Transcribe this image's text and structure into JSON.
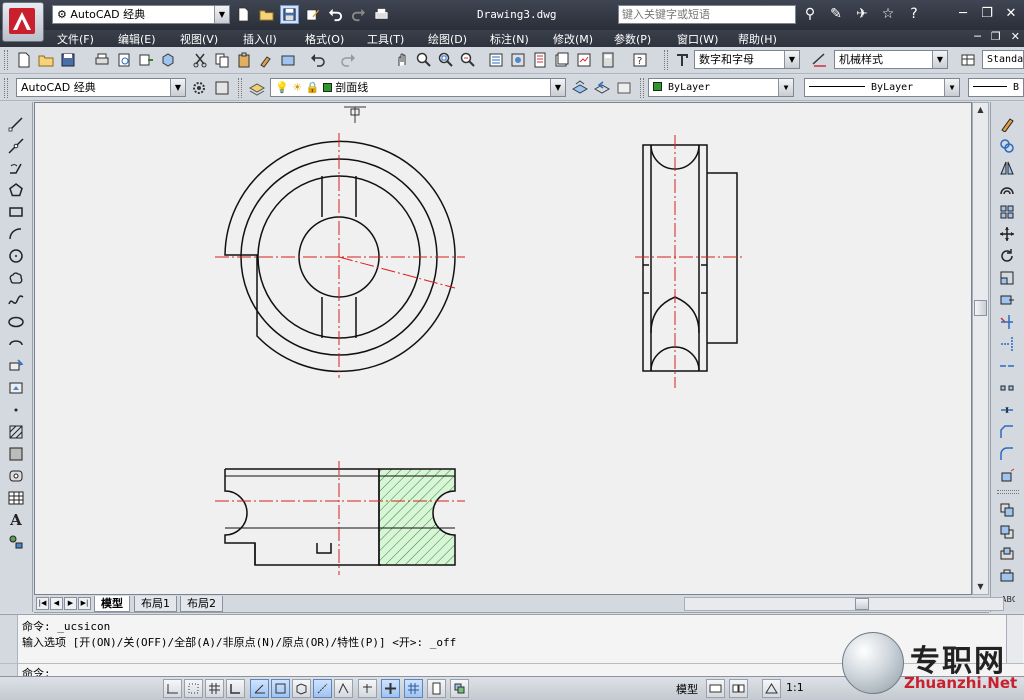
{
  "titlebar": {
    "workspace": "AutoCAD 经典",
    "document": "Drawing3.dwg",
    "search_placeholder": "键入关键字或短语"
  },
  "menu": [
    "文件(F)",
    "编辑(E)",
    "视图(V)",
    "插入(I)",
    "格式(O)",
    "工具(T)",
    "绘图(D)",
    "标注(N)",
    "修改(M)",
    "参数(P)",
    "窗口(W)",
    "帮助(H)"
  ],
  "toolbar1": {
    "text_style": "数字和字母",
    "dim_style": "机械样式",
    "table_style": "Standa"
  },
  "toolbar2": {
    "workspace": "AutoCAD 经典",
    "layer": "剖面线",
    "color": "ByLayer",
    "linetype": "ByLayer",
    "lineweight": "B"
  },
  "layout_tabs": [
    "模型",
    "布局1",
    "布局2"
  ],
  "command": {
    "line1_prefix": "命令:",
    "line1_cmd": "_ucsicon",
    "line2": "输入选项 [开(ON)/关(OFF)/全部(A)/非原点(N)/原点(OR)/特性(P)] <开>: _off",
    "prompt": "命令:"
  },
  "status": {
    "model": "模型",
    "scale": "1:1"
  },
  "colors": {
    "centerline": "#d81e1e",
    "hatch": "#2a8a2a",
    "hatch_fill": "#d8f5d8",
    "brand_red": "#c8202c"
  },
  "watermark": {
    "brand": "专职网",
    "url": "Zhuanzhi.Net"
  }
}
